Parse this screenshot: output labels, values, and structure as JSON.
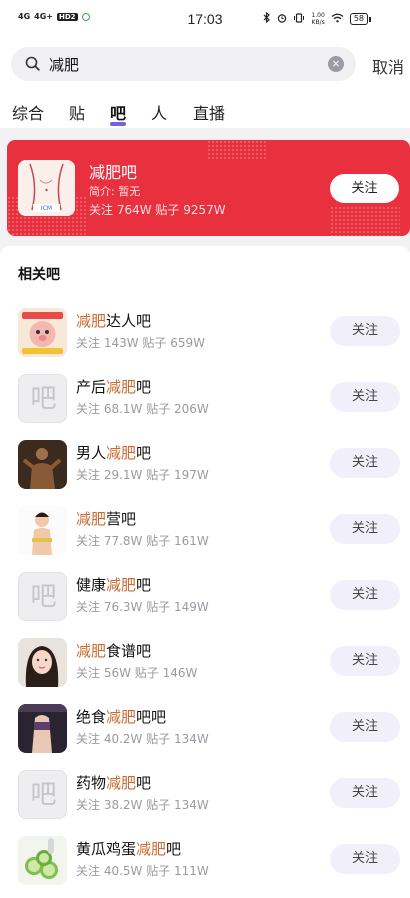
{
  "status_bar": {
    "signal_1": "4G",
    "signal_2": "4G+",
    "hd": "HD2",
    "time": "17:03",
    "net_speed_value": "1.00",
    "net_speed_unit": "KB/s",
    "battery": "58"
  },
  "search": {
    "query": "减肥",
    "cancel_label": "取消"
  },
  "tabs": [
    {
      "label": "综合"
    },
    {
      "label": "贴"
    },
    {
      "label": "吧",
      "active": true
    },
    {
      "label": "人"
    },
    {
      "label": "直播"
    }
  ],
  "hero": {
    "name": "减肥吧",
    "intro": "简介: 暂无",
    "stats": "关注 764W    贴子 9257W",
    "follow_label": "关注",
    "background_color": "#e8303e"
  },
  "related": {
    "title": "相关吧",
    "items": [
      {
        "name_prefix": "",
        "name_highlight": "减肥",
        "name_suffix": "达人吧",
        "stats": "关注 143W 贴子 659W",
        "follow_label": "关注",
        "avatar": "cartoon-image"
      },
      {
        "name_prefix": "产后",
        "name_highlight": "减肥",
        "name_suffix": "吧",
        "stats": "关注 68.1W 贴子 206W",
        "follow_label": "关注",
        "avatar": "placeholder",
        "placeholder_glyph": "吧"
      },
      {
        "name_prefix": "男人",
        "name_highlight": "减肥",
        "name_suffix": "吧",
        "stats": "关注 29.1W 贴子 197W",
        "follow_label": "关注",
        "avatar": "photo"
      },
      {
        "name_prefix": "",
        "name_highlight": "减肥",
        "name_suffix": "营吧",
        "stats": "关注 77.8W 贴子 161W",
        "follow_label": "关注",
        "avatar": "photo"
      },
      {
        "name_prefix": "健康",
        "name_highlight": "减肥",
        "name_suffix": "吧",
        "stats": "关注 76.3W 贴子 149W",
        "follow_label": "关注",
        "avatar": "placeholder",
        "placeholder_glyph": "吧"
      },
      {
        "name_prefix": "",
        "name_highlight": "减肥",
        "name_suffix": "食谱吧",
        "stats": "关注 56W 贴子 146W",
        "follow_label": "关注",
        "avatar": "photo"
      },
      {
        "name_prefix": "绝食",
        "name_highlight": "减肥",
        "name_suffix": "吧吧",
        "stats": "关注 40.2W 贴子 134W",
        "follow_label": "关注",
        "avatar": "photo"
      },
      {
        "name_prefix": "药物",
        "name_highlight": "减肥",
        "name_suffix": "吧",
        "stats": "关注 38.2W 贴子 134W",
        "follow_label": "关注",
        "avatar": "placeholder",
        "placeholder_glyph": "吧"
      },
      {
        "name_prefix": "黄瓜鸡蛋",
        "name_highlight": "减肥",
        "name_suffix": "吧",
        "stats": "关注 40.5W 贴子 111W",
        "follow_label": "关注",
        "avatar": "photo"
      }
    ]
  },
  "colors": {
    "accent": "#6c63e8",
    "highlight": "#c96b32",
    "follow_bg": "#f0effa"
  }
}
